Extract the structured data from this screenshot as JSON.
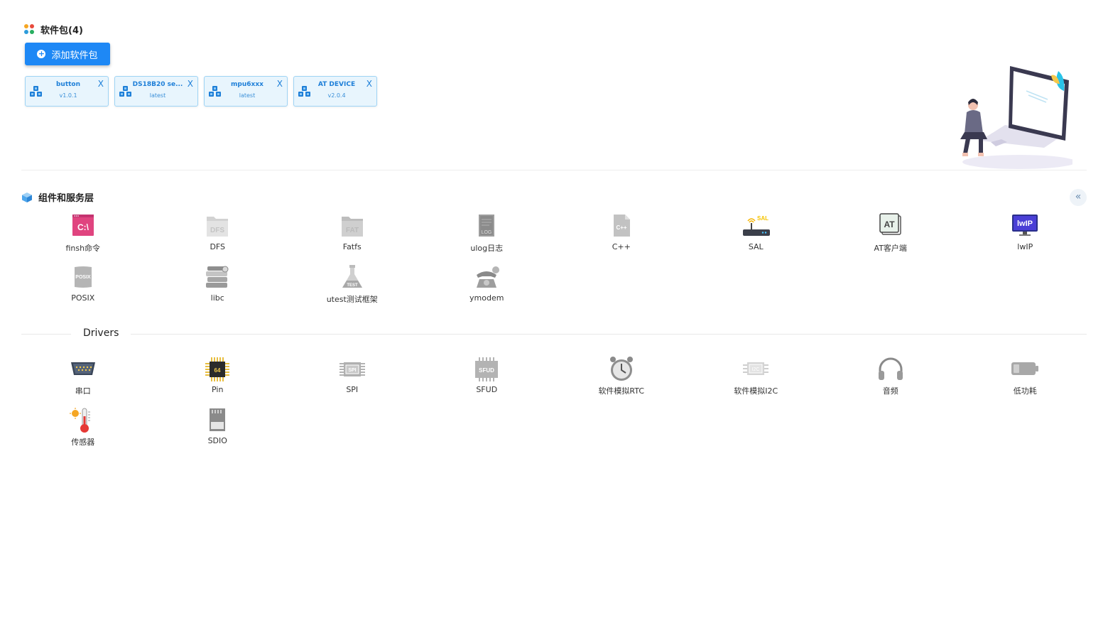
{
  "packages": {
    "title": "软件包(4)",
    "add_button": "添加软件包",
    "close_glyph": "X",
    "items": [
      {
        "name": "button",
        "version": "v1.0.1"
      },
      {
        "name": "DS18B20 se...",
        "version": "latest"
      },
      {
        "name": "mpu6xxx",
        "version": "latest"
      },
      {
        "name": "AT DEVICE",
        "version": "v2.0.4"
      }
    ]
  },
  "components": {
    "title": "组件和服务层",
    "collapse_glyph": "«",
    "items": [
      {
        "label": "finsh命令",
        "icon": "terminal-icon"
      },
      {
        "label": "DFS",
        "icon": "dfs-folder-icon"
      },
      {
        "label": "Fatfs",
        "icon": "fat-folder-icon"
      },
      {
        "label": "ulog日志",
        "icon": "log-file-icon"
      },
      {
        "label": "C++",
        "icon": "cpp-file-icon"
      },
      {
        "label": "SAL",
        "icon": "router-icon"
      },
      {
        "label": "AT客户端",
        "icon": "at-client-icon"
      },
      {
        "label": "lwIP",
        "icon": "lwip-monitor-icon"
      },
      {
        "label": "POSIX",
        "icon": "posix-scroll-icon"
      },
      {
        "label": "libc",
        "icon": "books-icon"
      },
      {
        "label": "utest测试框架",
        "icon": "test-flask-icon"
      },
      {
        "label": "ymodem",
        "icon": "telephone-icon"
      }
    ]
  },
  "drivers": {
    "title": "Drivers",
    "items": [
      {
        "label": "串口",
        "icon": "serial-port-icon"
      },
      {
        "label": "Pin",
        "icon": "chip-icon"
      },
      {
        "label": "SPI",
        "icon": "spi-chip-icon"
      },
      {
        "label": "SFUD",
        "icon": "sfud-chip-icon"
      },
      {
        "label": "软件模拟RTC",
        "icon": "alarm-clock-icon"
      },
      {
        "label": "软件模拟I2C",
        "icon": "i2c-chip-icon"
      },
      {
        "label": "音频",
        "icon": "headphones-icon"
      },
      {
        "label": "低功耗",
        "icon": "battery-icon"
      },
      {
        "label": "传感器",
        "icon": "thermometer-icon"
      },
      {
        "label": "SDIO",
        "icon": "sd-card-icon"
      }
    ]
  },
  "icon_text": {
    "terminal": "C:\\",
    "dfs": "DFS",
    "fat": "FAT",
    "log": "LOG",
    "cpp": "C++",
    "sal": "SAL",
    "at": "AT",
    "lwip": "lwIP",
    "posix": "POSIX",
    "test": "TEST",
    "pin": "64",
    "spi": "SPI",
    "sfud": "SFUD",
    "i2c": "I2C"
  },
  "colors": {
    "primary": "#1e88f5",
    "card_bg": "#e8f5fd",
    "card_border": "#9fd4f5"
  }
}
